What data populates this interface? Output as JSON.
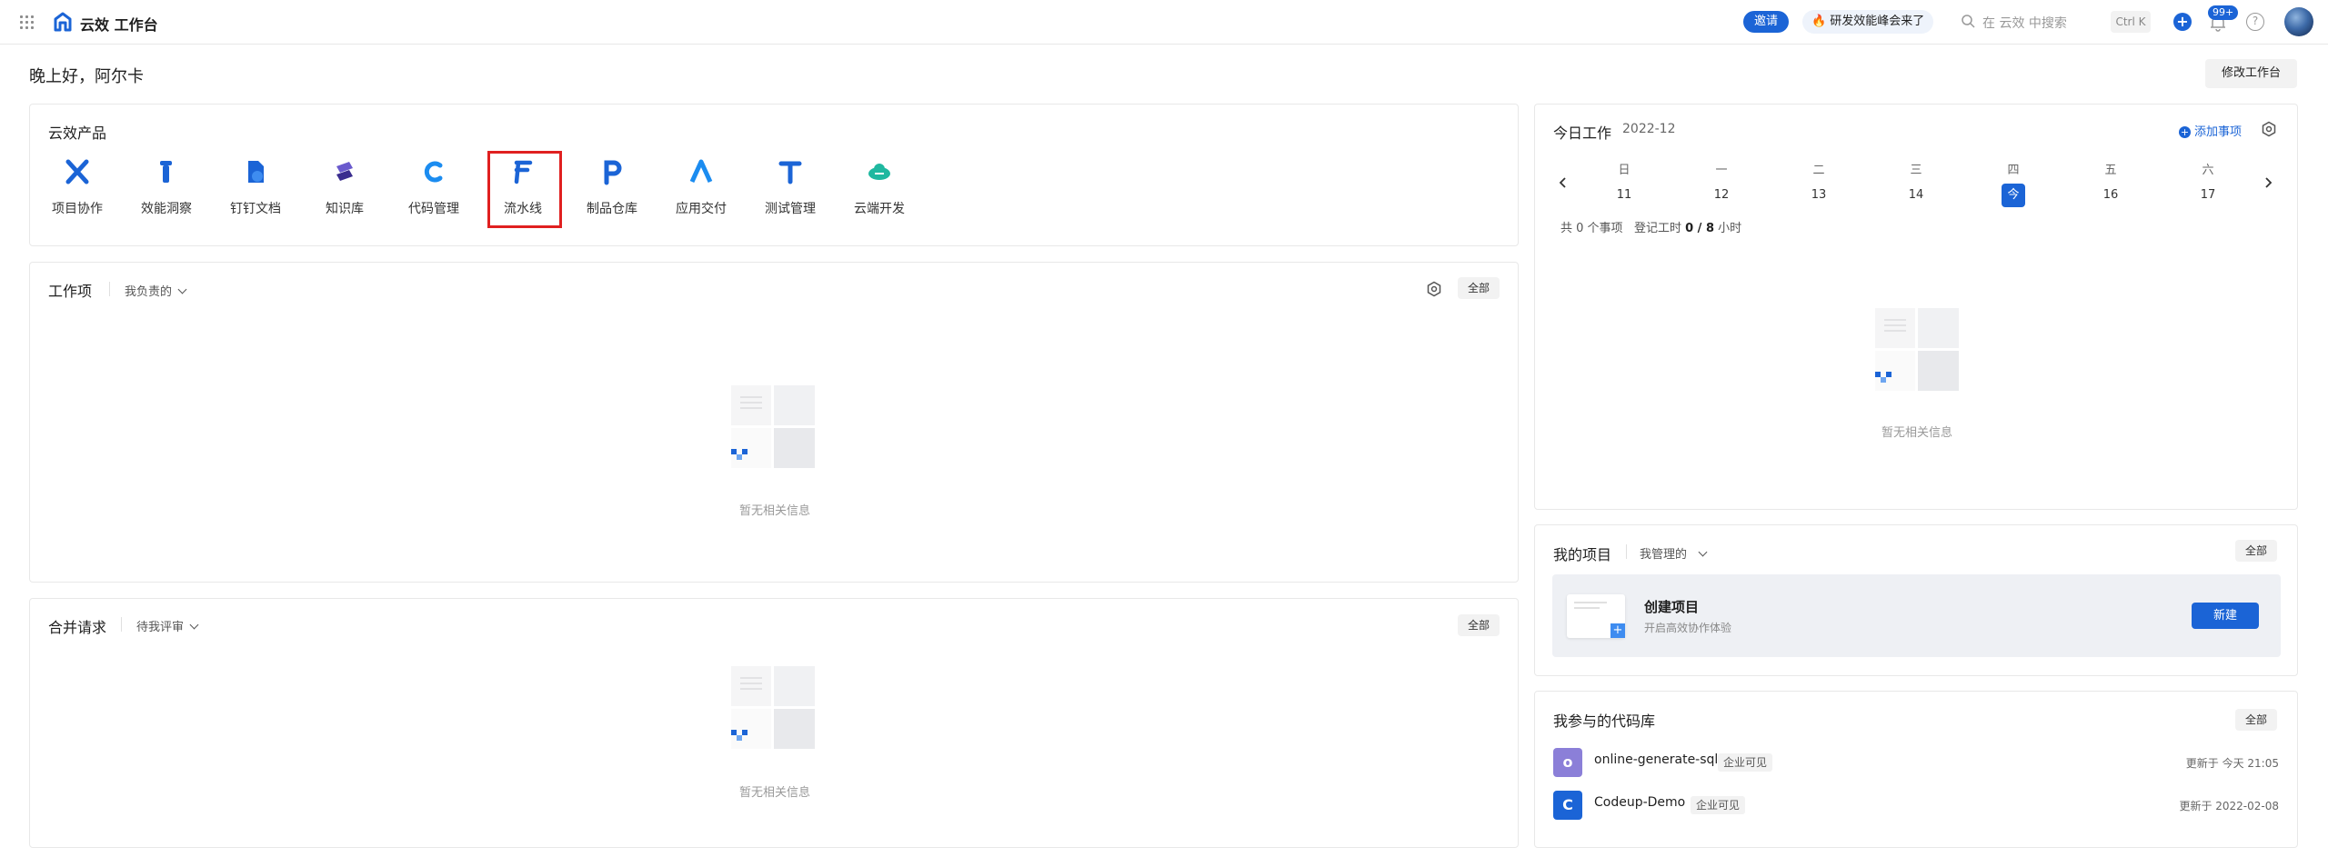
{
  "header": {
    "brand": "云效 工作台",
    "invite_label": "邀请",
    "promo_label": "研发效能峰会来了",
    "search_placeholder": "在 云效 中搜索",
    "shortcut": "Ctrl K",
    "notification_count": "99+"
  },
  "greeting": "晚上好，阿尔卡",
  "edit_workspace_label": "修改工作台",
  "products": {
    "title": "云效产品",
    "items": [
      {
        "label": "项目协作",
        "icon": "project-icon"
      },
      {
        "label": "效能洞察",
        "icon": "insight-icon"
      },
      {
        "label": "钉钉文档",
        "icon": "doc-icon"
      },
      {
        "label": "知识库",
        "icon": "knowledge-icon"
      },
      {
        "label": "代码管理",
        "icon": "code-icon"
      },
      {
        "label": "流水线",
        "icon": "pipeline-icon"
      },
      {
        "label": "制品仓库",
        "icon": "package-icon"
      },
      {
        "label": "应用交付",
        "icon": "delivery-icon"
      },
      {
        "label": "测试管理",
        "icon": "test-icon"
      },
      {
        "label": "云端开发",
        "icon": "cloud-dev-icon"
      }
    ]
  },
  "work_items": {
    "title": "工作项",
    "filter": "我负责的",
    "all_label": "全部",
    "empty_text": "暂无相关信息"
  },
  "merge_requests": {
    "title": "合并请求",
    "filter": "待我评审",
    "all_label": "全部",
    "empty_text": "暂无相关信息"
  },
  "today": {
    "title": "今日工作",
    "month": "2022-12",
    "add_label": "添加事项",
    "weekdays": [
      "日",
      "一",
      "二",
      "三",
      "四",
      "五",
      "六"
    ],
    "dates": [
      "11",
      "12",
      "13",
      "14",
      "今",
      "16",
      "17"
    ],
    "summary_prefix": "共 0 个事项",
    "hours_prefix": "登记工时",
    "hours_value": "0 / 8",
    "hours_unit": "小时",
    "empty_text": "暂无相关信息"
  },
  "my_projects": {
    "title": "我的项目",
    "filter": "我管理的",
    "all_label": "全部",
    "create_title": "创建项目",
    "create_subtitle": "开启高效协作体验",
    "new_label": "新建"
  },
  "repos": {
    "title": "我参与的代码库",
    "all_label": "全部",
    "items": [
      {
        "name": "online-generate-sql",
        "tag": "企业可见",
        "updated": "更新于 今天 21:05",
        "color": "#8b7fd8",
        "initial": "o"
      },
      {
        "name": "Codeup-Demo",
        "tag": "企业可见",
        "updated": "更新于 2022-02-08",
        "color": "#1b64d6",
        "initial": "C"
      }
    ]
  },
  "colors": {
    "primary": "#1b64d6",
    "highlight": "#e02020"
  }
}
